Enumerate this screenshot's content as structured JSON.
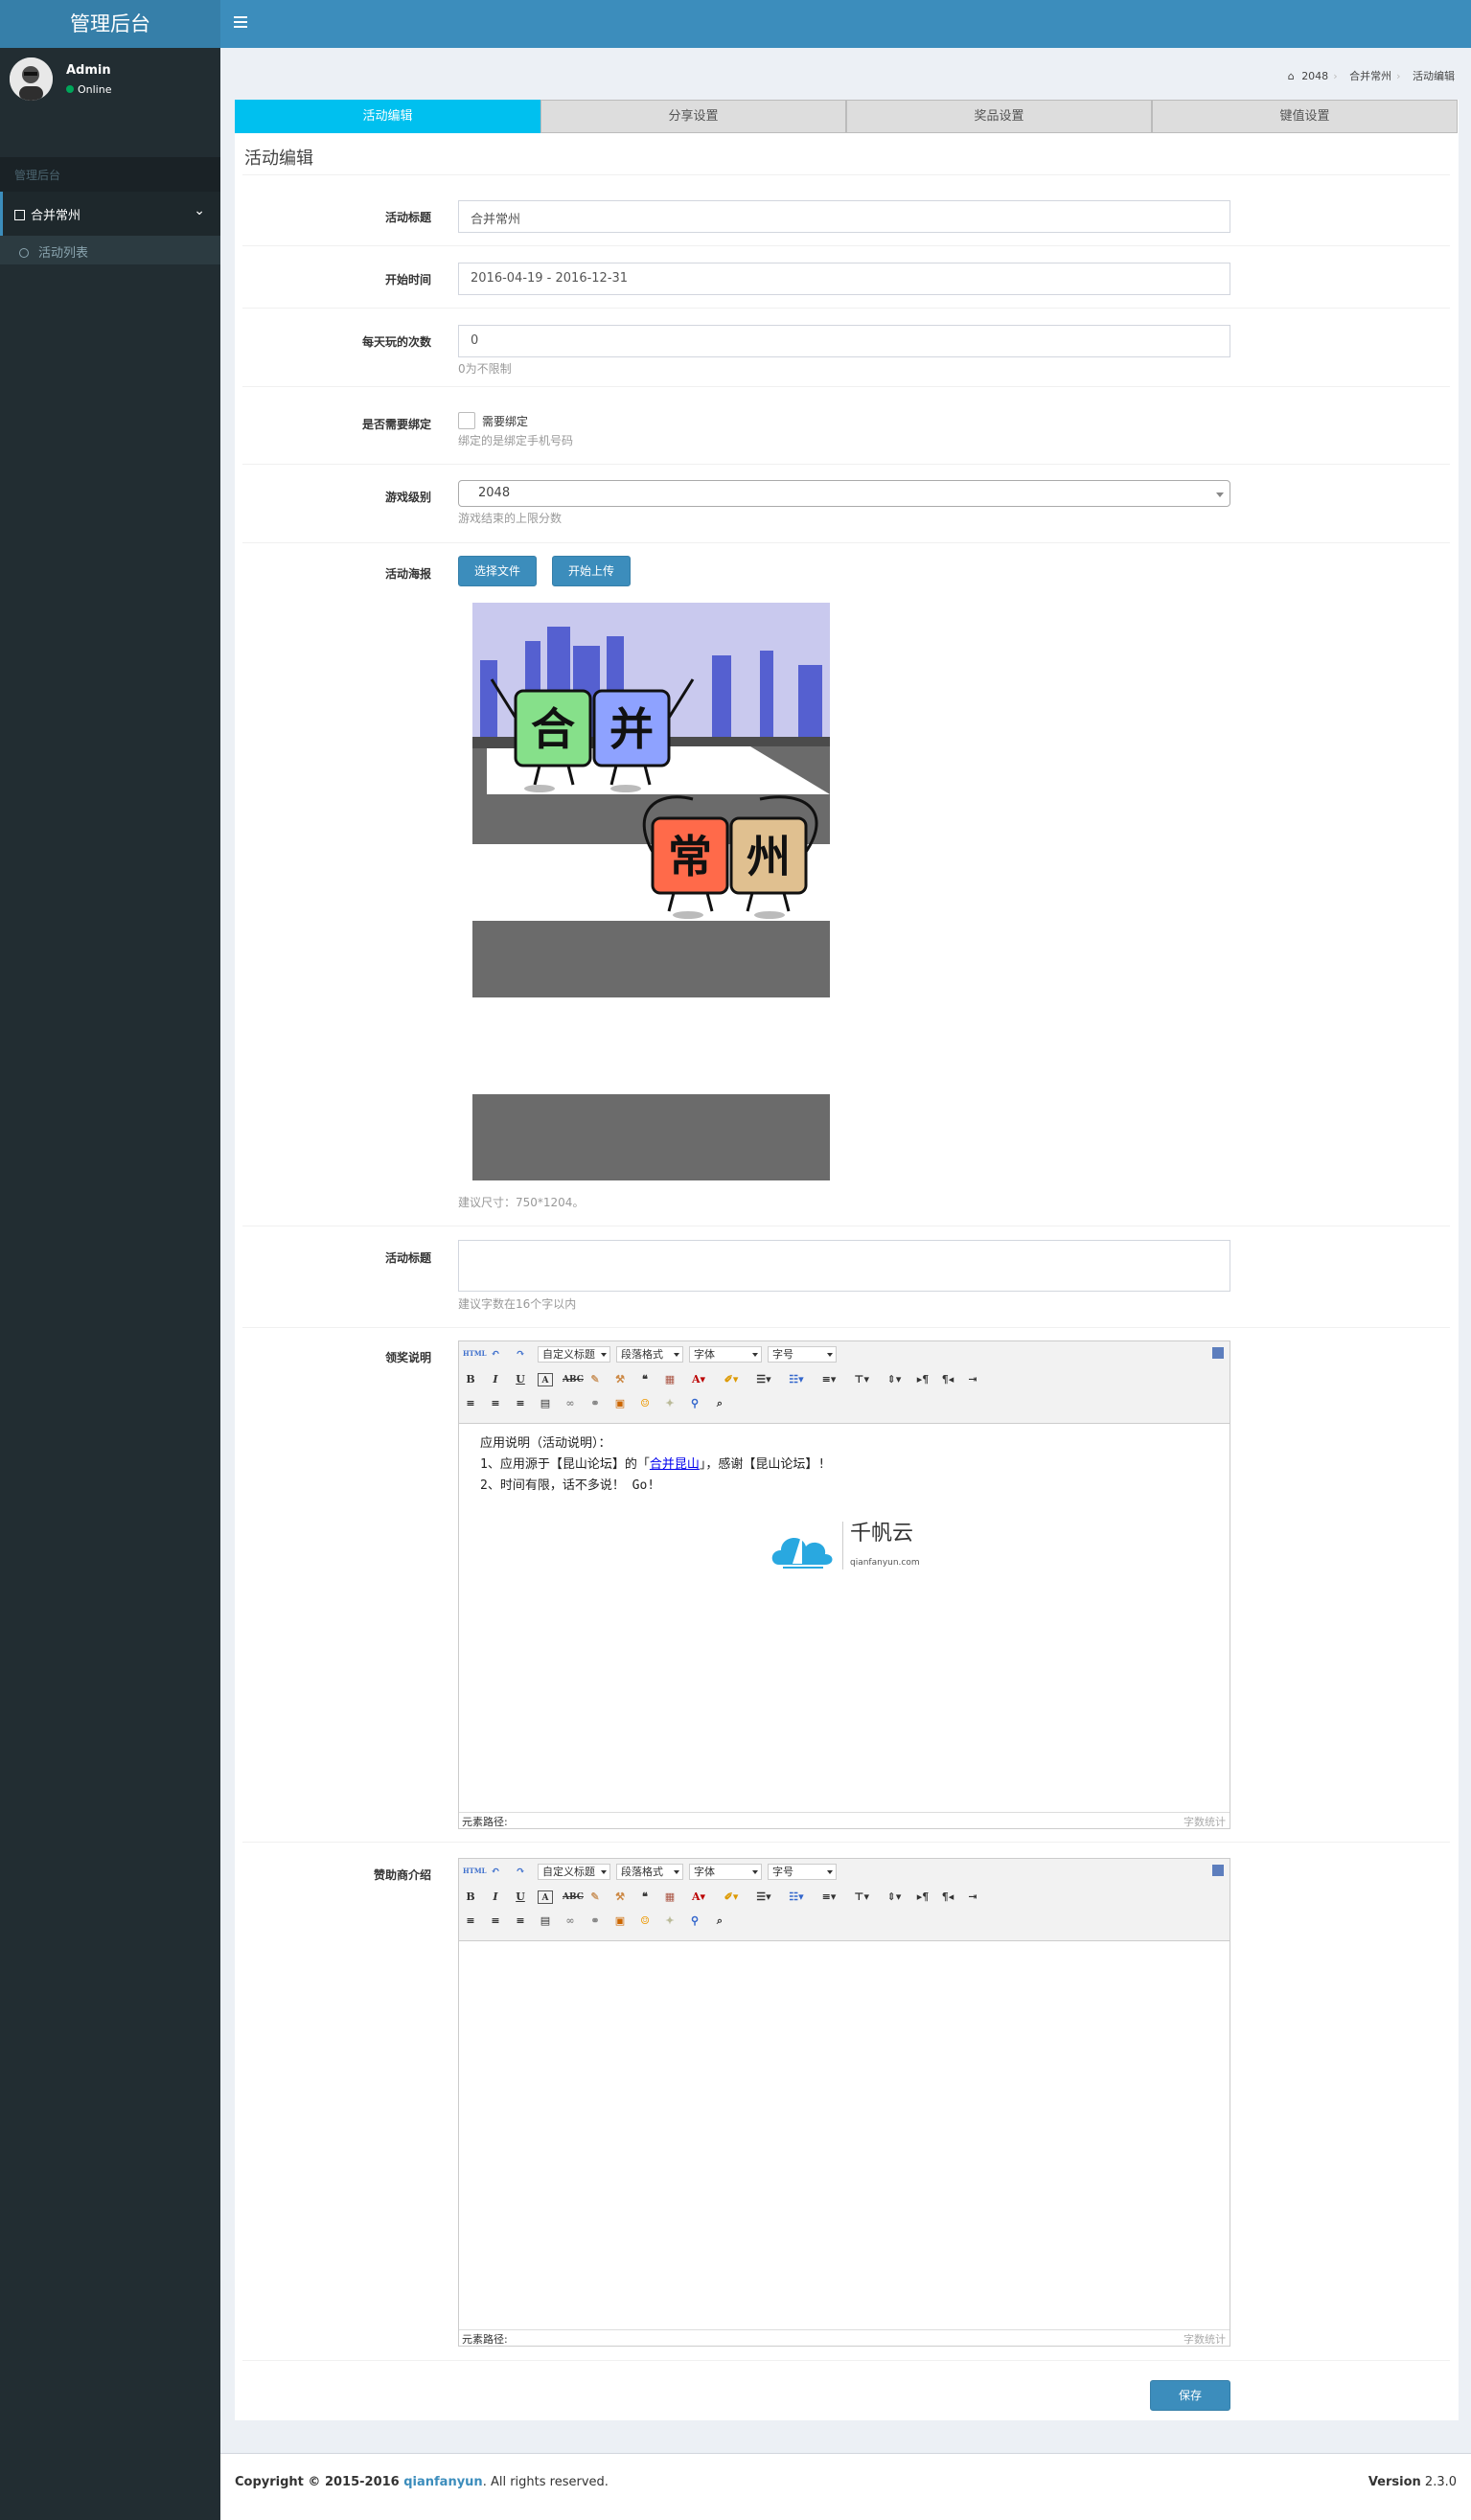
{
  "app": {
    "title": "管理后台"
  },
  "user": {
    "name": "Admin",
    "status": "Online"
  },
  "sidebar": {
    "header": "管理后台",
    "items": [
      {
        "label": "合并常州",
        "sub": [
          {
            "label": "活动列表"
          }
        ]
      }
    ]
  },
  "breadcrumb": [
    "2048",
    "合并常州",
    "活动编辑"
  ],
  "tabs": [
    {
      "label": "活动编辑",
      "active": true
    },
    {
      "label": "分享设置",
      "active": false
    },
    {
      "label": "奖品设置",
      "active": false
    },
    {
      "label": "键值设置",
      "active": false
    }
  ],
  "form": {
    "section_title": "活动编辑",
    "title_label": "活动标题",
    "title_value": "合并常州",
    "time_label": "开始时间",
    "time_value": "2016-04-19 - 2016-12-31",
    "plays_label": "每天玩的次数",
    "plays_value": "0",
    "plays_help": "0为不限制",
    "bind_label": "是否需要绑定",
    "bind_checkbox": "需要绑定",
    "bind_help": "绑定的是绑定手机号码",
    "level_label": "游戏级别",
    "level_value": "2048",
    "level_help": "游戏结束的上限分数",
    "poster_label": "活动海报",
    "choose_file": "选择文件",
    "start_upload": "开始上传",
    "poster_help": "建议尺寸：750*1204。",
    "title2_label": "活动标题",
    "title2_value": "",
    "title2_help": "建议字数在16个字以内",
    "prize_label": "领奖说明",
    "sponsor_label": "赞助商介绍",
    "save": "保存"
  },
  "poster": {
    "tiles": [
      "合",
      "并",
      "常",
      "州"
    ]
  },
  "editor_toolbar": {
    "html": "HTML",
    "custom_title": "自定义标题",
    "paragraph": "段落格式",
    "font": "字体",
    "size": "字号",
    "path_label": "元素路径:",
    "count_label": "字数统计"
  },
  "prize_editor": {
    "line1": "应用说明（活动说明）：",
    "line2_a": "1、应用源于【昆山论坛】的「",
    "line2_link": "合并昆山",
    "line2_b": "」，感谢【昆山论坛】!",
    "line3": "2、时间有限，话不多说！ Go!",
    "logo_cn": "千帆云",
    "logo_en": "qianfanyun.com"
  },
  "footer": {
    "copyright_a": "Copyright © 2015-2016 ",
    "copyright_link": "qianfanyun",
    "copyright_b": ". All rights reserved.",
    "version_label": "Version",
    "version_value": "2.3.0"
  }
}
